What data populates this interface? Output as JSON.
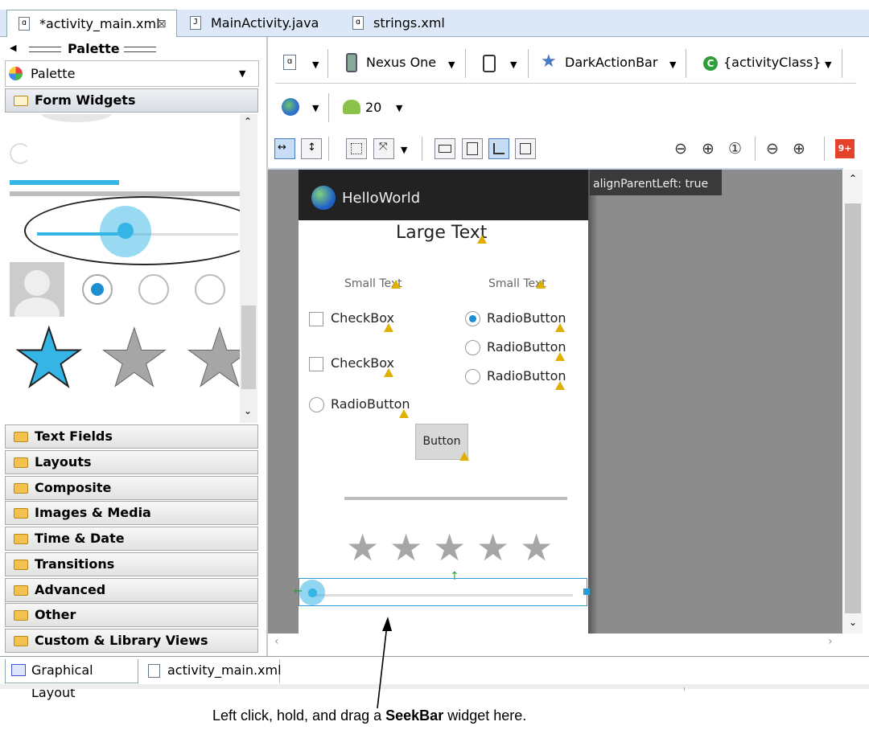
{
  "editor_tabs": [
    {
      "label": "*activity_main.xml",
      "close": "⊠"
    },
    {
      "label": "MainActivity.java"
    },
    {
      "label": "strings.xml"
    }
  ],
  "palette": {
    "header": "Palette",
    "dropdown_label": "Palette",
    "open_category": "Form Widgets",
    "categories": [
      "Text Fields",
      "Layouts",
      "Composite",
      "Images & Media",
      "Time & Date",
      "Transitions",
      "Advanced",
      "Other",
      "Custom & Library Views"
    ]
  },
  "toolbar": {
    "device": "Nexus One",
    "theme": "DarkActionBar",
    "activity": "{activityClass}",
    "api_level": "20",
    "badge": "9+"
  },
  "canvas": {
    "tooltip_lines": [
      "alignParentLeft: true"
    ],
    "action_bar_title": "HelloWorld",
    "large_text": "Large Text",
    "small_text_1": "Small Text",
    "small_text_2": "Small Text",
    "checkbox_1": "CheckBox",
    "checkbox_2": "CheckBox",
    "radio_left": "RadioButton",
    "radio_right_1": "RadioButton",
    "radio_right_2": "RadioButton",
    "radio_right_3": "RadioButton",
    "button": "Button",
    "rating_stars": 5,
    "rating_value": 0
  },
  "bottom_tabs": [
    {
      "label": "Graphical Layout"
    },
    {
      "label": "activity_main.xml"
    }
  ],
  "caption": {
    "before": "Left click, hold, and drag a ",
    "bold": "SeekBar",
    "after": " widget here."
  }
}
